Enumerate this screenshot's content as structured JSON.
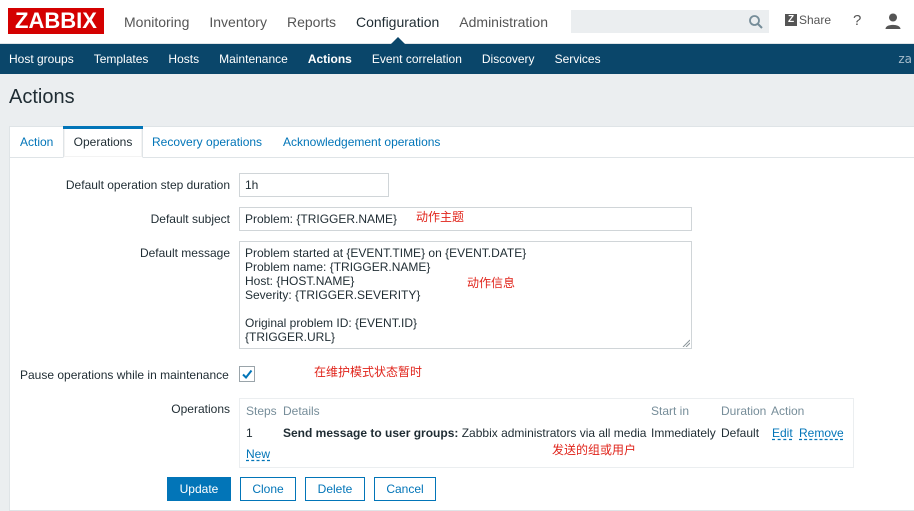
{
  "header": {
    "logo": "ZABBIX",
    "menu": [
      "Monitoring",
      "Inventory",
      "Reports",
      "Configuration",
      "Administration"
    ],
    "share_label": "Share",
    "share_badge": "Z",
    "help_label": "?"
  },
  "subnav": {
    "items": [
      "Host groups",
      "Templates",
      "Hosts",
      "Maintenance",
      "Actions",
      "Event correlation",
      "Discovery",
      "Services"
    ],
    "selected": "Actions",
    "trailing": "za"
  },
  "page": {
    "title": "Actions"
  },
  "tabs": [
    "Action",
    "Operations",
    "Recovery operations",
    "Acknowledgement operations"
  ],
  "form": {
    "step_duration_label": "Default operation step duration",
    "step_duration_value": "1h",
    "subject_label": "Default subject",
    "subject_value": "Problem: {TRIGGER.NAME}",
    "message_label": "Default message",
    "message_lines": [
      "Problem started at {EVENT.TIME} on {EVENT.DATE}",
      "Problem name: {TRIGGER.NAME}",
      "Host: {HOST.NAME}",
      "Severity: {TRIGGER.SEVERITY}",
      "",
      "Original problem ID: {EVENT.ID}",
      "{TRIGGER.URL}"
    ],
    "pause_label": "Pause operations while in maintenance",
    "pause_checked": true,
    "operations_label": "Operations"
  },
  "operations": {
    "headers": {
      "steps": "Steps",
      "details": "Details",
      "start_in": "Start in",
      "duration": "Duration",
      "action": "Action"
    },
    "rows": [
      {
        "step": "1",
        "details_bold": "Send message to user groups:",
        "details_rest": " Zabbix administrators via all media",
        "start_in": "Immediately",
        "duration": "Default",
        "edit": "Edit",
        "remove": "Remove"
      }
    ],
    "new_label": "New"
  },
  "annotations": {
    "subject": "动作主题",
    "message": "动作信息",
    "pause": "在维护模式状态暂时",
    "operations": "发送的组或用户"
  },
  "buttons": {
    "update": "Update",
    "clone": "Clone",
    "delete": "Delete",
    "cancel": "Cancel"
  },
  "colors": {
    "logo": "#d40000",
    "nav": "#0a466a",
    "link": "#0275b8",
    "annotation": "#e0241b"
  }
}
